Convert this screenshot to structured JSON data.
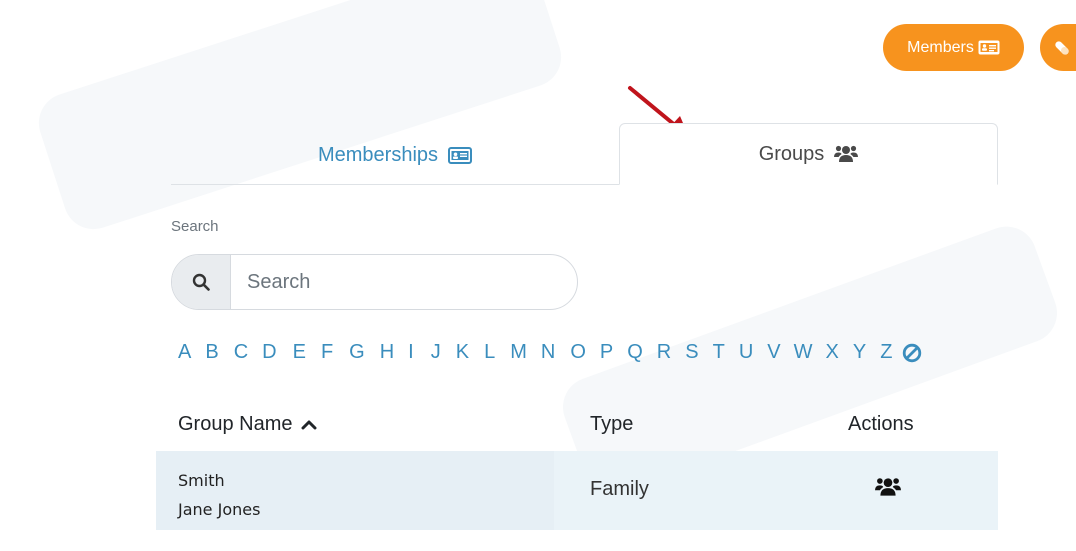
{
  "header": {
    "members_button": {
      "label": "Members",
      "icon": "id-card-icon"
    },
    "tool_button": {
      "icon": "pill-icon"
    }
  },
  "tabs": [
    {
      "label": "Memberships",
      "icon": "id-card-icon",
      "active": false
    },
    {
      "label": "Groups",
      "icon": "users-icon",
      "active": true
    }
  ],
  "search": {
    "label": "Search",
    "placeholder": "Search",
    "value": "",
    "icon": "search-icon"
  },
  "alphabet": {
    "letters": [
      "A",
      "B",
      "C",
      "D",
      "E",
      "F",
      "G",
      "H",
      "I",
      "J",
      "K",
      "L",
      "M",
      "N",
      "O",
      "P",
      "Q",
      "R",
      "S",
      "T",
      "U",
      "V",
      "W",
      "X",
      "Y",
      "Z"
    ],
    "clear_icon": "ban-icon"
  },
  "table": {
    "headers": {
      "name": "Group Name",
      "type": "Type",
      "actions": "Actions"
    },
    "sort_icon": "chevron-up-icon",
    "rows": [
      {
        "name_line1": "Smith",
        "name_line2": "Jane Jones",
        "type": "Family",
        "action_icon": "users-icon"
      }
    ]
  },
  "colors": {
    "accent_orange": "#f7931e",
    "link_blue": "#3a8dbd",
    "row_highlight": "#eaf3f8",
    "annotation_red": "#c0141c"
  }
}
